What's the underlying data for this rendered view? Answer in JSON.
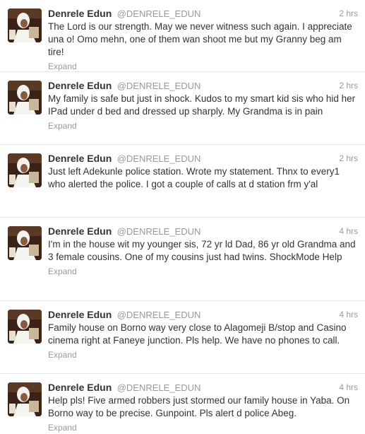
{
  "tweets": [
    {
      "name": "Denrele Edun",
      "handle": "@DENRELE_EDUN",
      "time": "2 hrs",
      "text": "The Lord is our strength. May we never witness such again. I appreciate una o! Omo mehn, one of them wan shoot me but my Granny beg am tire!",
      "expand": "Expand"
    },
    {
      "name": "Denrele Edun",
      "handle": "@DENRELE_EDUN",
      "time": "2 hrs",
      "text": "My family is safe but just in shock. Kudos to my smart kid sis who hid her IPad under d bed and dressed up sharply. My Grandma is in pain",
      "expand": "Expand"
    },
    {
      "name": "Denrele Edun",
      "handle": "@DENRELE_EDUN",
      "time": "2 hrs",
      "text": "Just left Adekunle police station. Wrote my statement. Thnx to every1 who alerted the police. I got a couple of calls at d station frm y'al",
      "expand": ""
    },
    {
      "name": "Denrele Edun",
      "handle": "@DENRELE_EDUN",
      "time": "4 hrs",
      "text": "I'm in the house wit my younger sis, 72 yr ld Dad, 86 yr old Grandma and 3 female cousins. One of my cousins just had twins. ShockMode Help",
      "expand": "Expand"
    },
    {
      "name": "Denrele Edun",
      "handle": "@DENRELE_EDUN",
      "time": "4 hrs",
      "text": "Family house on Borno way very close to Alagomeji B/stop and Casino cinema right at Faneye junction. Pls help. We have no phones to call.",
      "expand": "Expand"
    },
    {
      "name": "Denrele Edun",
      "handle": "@DENRELE_EDUN",
      "time": "4 hrs",
      "text": "Help pls! Five armed robbers just stormed our family house in Yaba. On Borno way to be precise. Gunpoint. Pls alert d police Abeg.",
      "expand": "Expand"
    }
  ]
}
